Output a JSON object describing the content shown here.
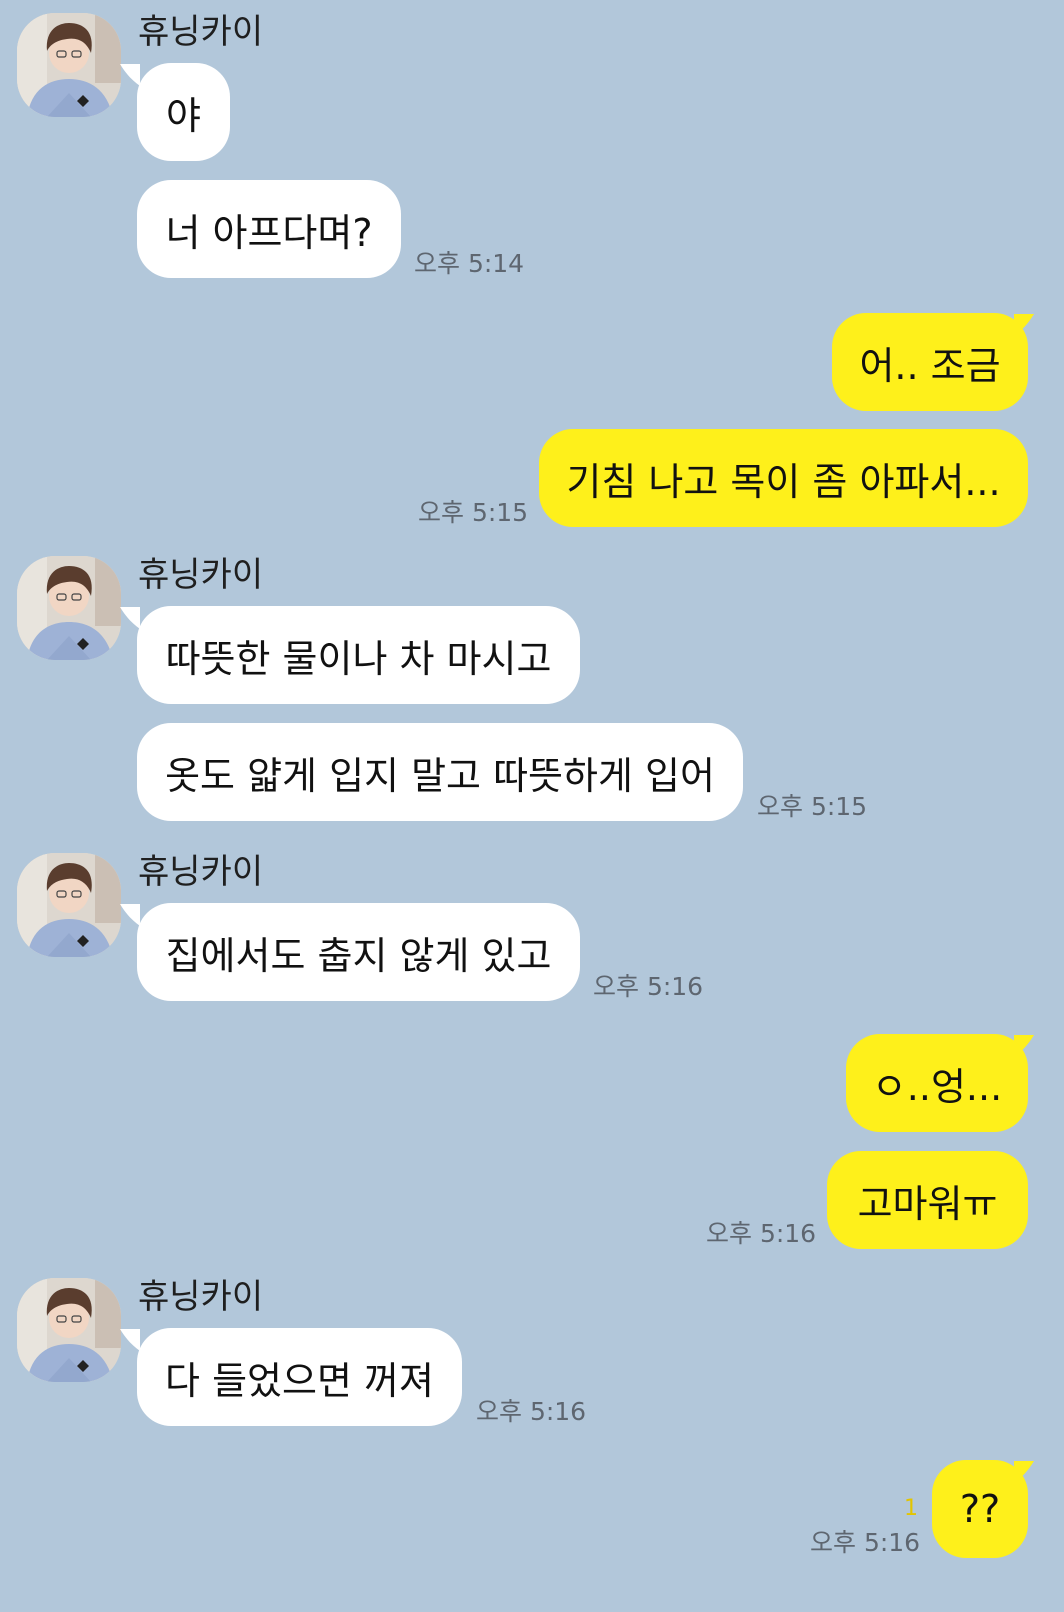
{
  "chat": {
    "sender_name": "휴닝카이",
    "messages": [
      {
        "from": "other",
        "text": "야"
      },
      {
        "from": "other",
        "text": "너 아프다며?",
        "time": "오후 5:14"
      },
      {
        "from": "me",
        "text": "어.. 조금"
      },
      {
        "from": "me",
        "text": "기침 나고 목이 좀 아파서...",
        "time": "오후 5:15"
      },
      {
        "from": "other",
        "text": "따뜻한 물이나 차 마시고"
      },
      {
        "from": "other",
        "text": "옷도 얇게 입지 말고 따뜻하게 입어",
        "time": "오후 5:15"
      },
      {
        "from": "other",
        "text": "집에서도 춥지 않게 있고",
        "time": "오후 5:16"
      },
      {
        "from": "me",
        "text": "ㅇ..엉..."
      },
      {
        "from": "me",
        "text": "고마워ㅠ",
        "time": "오후 5:16"
      },
      {
        "from": "other",
        "text": "다 들었으면 꺼져",
        "time": "오후 5:16"
      },
      {
        "from": "me",
        "text": "??",
        "time": "오후 5:16",
        "unread": "1"
      }
    ]
  },
  "colors": {
    "background": "#b2c7da",
    "incoming_bubble": "#ffffff",
    "outgoing_bubble": "#fef01b",
    "timestamp": "#5e6670",
    "unread_count": "#e3c500"
  },
  "icons": {
    "avatar": "profile-photo"
  }
}
